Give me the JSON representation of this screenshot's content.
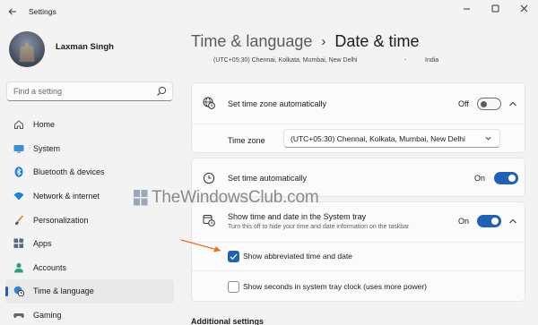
{
  "window": {
    "title": "Settings",
    "controls": [
      "minimize",
      "maximize",
      "close"
    ]
  },
  "profile": {
    "name": "Laxman Singh"
  },
  "search": {
    "placeholder": "Find a setting"
  },
  "sidebar": {
    "items": [
      {
        "label": "Home",
        "icon": "home-icon",
        "active": false
      },
      {
        "label": "System",
        "icon": "system-icon",
        "active": false
      },
      {
        "label": "Bluetooth & devices",
        "icon": "bluetooth-icon",
        "active": false
      },
      {
        "label": "Network & internet",
        "icon": "wifi-icon",
        "active": false
      },
      {
        "label": "Personalization",
        "icon": "brush-icon",
        "active": false
      },
      {
        "label": "Apps",
        "icon": "apps-icon",
        "active": false
      },
      {
        "label": "Accounts",
        "icon": "person-icon",
        "active": false
      },
      {
        "label": "Time & language",
        "icon": "globe-clock-icon",
        "active": true
      },
      {
        "label": "Gaming",
        "icon": "gaming-icon",
        "active": false
      }
    ]
  },
  "breadcrumb": {
    "parent": "Time & language",
    "separator": "›",
    "current": "Date & time"
  },
  "clipped_row": {
    "timezone": "(UTC+05:30) Chennai, Kolkata, Mumbai, New Delhi",
    "dash": "-",
    "country": "India"
  },
  "settings": {
    "tz_auto": {
      "label": "Set time zone automatically",
      "state": "Off",
      "icon": "globe-clock-icon"
    },
    "timezone": {
      "label": "Time zone",
      "value": "(UTC+05:30) Chennai, Kolkata, Mumbai, New Delhi"
    },
    "time_auto": {
      "label": "Set time automatically",
      "state": "On",
      "icon": "clock-icon"
    },
    "tray": {
      "label": "Show time and date in the System tray",
      "sub": "Turn this off to hide your time and date information on the taskbar",
      "state": "On",
      "icon": "calendar-clock-icon"
    },
    "abbrev": {
      "label": "Show abbreviated time and date",
      "checked": true
    },
    "seconds": {
      "label": "Show seconds in system tray clock (uses more power)",
      "checked": false
    }
  },
  "watermark": {
    "text": "TheWindowsClub.com"
  },
  "bottom_cut": {
    "text": "Additional settings"
  },
  "colors": {
    "accent": "#1f62b3",
    "annotation_arrow": "#e8721c"
  }
}
